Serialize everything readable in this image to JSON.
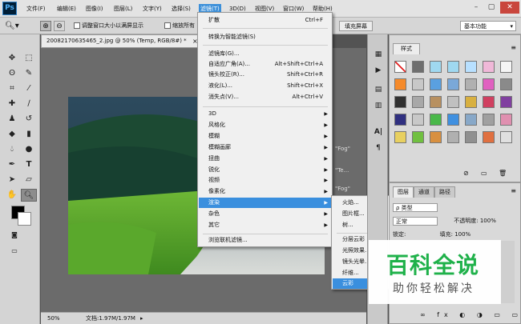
{
  "menubar": {
    "logo": "Ps",
    "items": [
      "文件(F)",
      "编辑(E)",
      "图像(I)",
      "图层(L)",
      "文字(Y)",
      "选择(S)",
      "滤镜(T)",
      "3D(D)",
      "视图(V)",
      "窗口(W)",
      "帮助(H)"
    ],
    "active_index": 6,
    "window_controls": [
      "–",
      "▢",
      "✕"
    ]
  },
  "options": {
    "resize_windows_label": "调整窗口大小以满屏显示",
    "zoom_all_label": "缩放所有",
    "fill_screen_button": "填充屏幕",
    "workspace": "基本功能"
  },
  "document": {
    "tab_title": "20082170635465_2.jpg @ 50% (Temp, RGB/8#) *",
    "close": "×",
    "zoom": "50%",
    "status": "文档:1.97M/1.97M"
  },
  "filter_menu": {
    "items": [
      {
        "label": "扩散",
        "shortcut": "Ctrl+F"
      },
      {
        "separator": true
      },
      {
        "label": "转换为智能滤镜(S)"
      },
      {
        "separator": true
      },
      {
        "label": "滤镜库(G)..."
      },
      {
        "label": "自适应广角(A)...",
        "shortcut": "Alt+Shift+Ctrl+A"
      },
      {
        "label": "镜头校正(R)...",
        "shortcut": "Shift+Ctrl+R"
      },
      {
        "label": "液化(L)...",
        "shortcut": "Shift+Ctrl+X"
      },
      {
        "label": "消失点(V)...",
        "shortcut": "Alt+Ctrl+V"
      },
      {
        "separator": true
      },
      {
        "label": "3D",
        "submenu": true
      },
      {
        "label": "风格化",
        "submenu": true
      },
      {
        "label": "模糊",
        "submenu": true
      },
      {
        "label": "模糊画廊",
        "submenu": true
      },
      {
        "label": "扭曲",
        "submenu": true
      },
      {
        "label": "锐化",
        "submenu": true
      },
      {
        "label": "视频",
        "submenu": true
      },
      {
        "label": "像素化",
        "submenu": true
      },
      {
        "label": "渲染",
        "submenu": true,
        "highlighted": true
      },
      {
        "label": "杂色",
        "submenu": true
      },
      {
        "label": "其它",
        "submenu": true
      },
      {
        "separator": true
      },
      {
        "label": "浏览联机滤镜..."
      }
    ]
  },
  "render_submenu": {
    "items": [
      {
        "label": "火焰..."
      },
      {
        "label": "图片框..."
      },
      {
        "label": "树..."
      },
      {
        "separator": true
      },
      {
        "label": "分层云彩"
      },
      {
        "label": "光照效果..."
      },
      {
        "label": "镜头光晕..."
      },
      {
        "label": "纤维..."
      },
      {
        "label": "云彩",
        "highlighted": true
      }
    ]
  },
  "right_panels": {
    "styles_tab": "样式",
    "layers_tabs": [
      "图层",
      "通道",
      "路径"
    ],
    "kind_label": "ρ 类型",
    "blend_mode": "正常",
    "opacity_label": "不透明度:",
    "opacity_value": "100%",
    "lock_label": "锁定:",
    "fill_label": "填充:",
    "fill_value": "100%"
  },
  "canvas_text": {
    "fog_1": "\"Fog\"",
    "fog_2": "\"Te...",
    "fog_3": "\"Fog\""
  },
  "watermark": {
    "title": "百科全说",
    "subtitle": "助你轻松解决"
  },
  "colors": {
    "menu_highlight": "#3a8fde",
    "watermark_green": "#1fb14a",
    "canvas_bg": "#6b6b6b"
  }
}
